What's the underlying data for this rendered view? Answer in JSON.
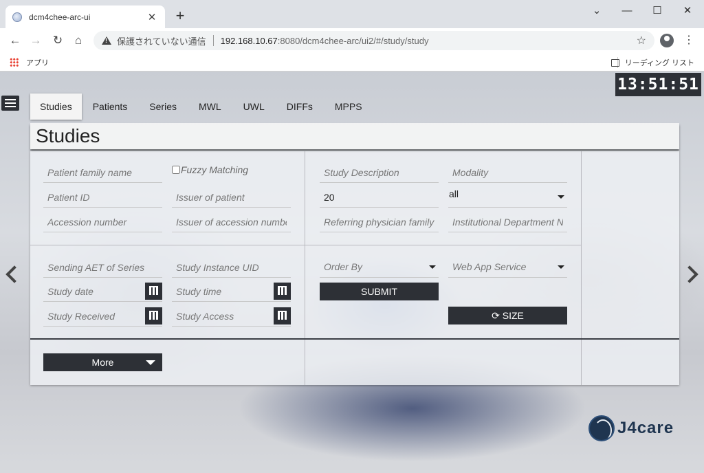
{
  "browser": {
    "tab_title": "dcm4chee-arc-ui",
    "tab_close": "✕",
    "new_tab": "+",
    "win_minimize": "⌄",
    "win_min": "—",
    "win_max": "☐",
    "win_close": "✕",
    "security_label": "保護されていない通信",
    "url_host": "192.168.10.67",
    "url_path": ":8080/dcm4chee-arc/ui2/#/study/study",
    "bookmark_apps": "アプリ",
    "reading_list": "リーディング リスト"
  },
  "clock": "13:51:51",
  "nav_tabs": [
    "Studies",
    "Patients",
    "Series",
    "MWL",
    "UWL",
    "DIFFs",
    "MPPS"
  ],
  "page_title": "Studies",
  "filters": {
    "patient_family_name": "Patient family name",
    "fuzzy_matching": "Fuzzy Matching",
    "patient_id": "Patient ID",
    "issuer_of_patient": "Issuer of patient",
    "accession_number": "Accession number",
    "issuer_of_accession": "Issuer of accession number",
    "study_description": "Study Description",
    "modality": "Modality",
    "limit_value": "20",
    "all_select": "all",
    "referring_physician": "Referring physician family name",
    "institutional_department": "Institutional Department Name",
    "sending_aet": "Sending AET of Series",
    "study_instance_uid": "Study Instance UID",
    "study_date": "Study date",
    "study_time": "Study time",
    "study_received": "Study Received",
    "study_access": "Study Access",
    "order_by": "Order By",
    "web_app_service": "Web App Service"
  },
  "buttons": {
    "submit": "SUBMIT",
    "size": "SIZE",
    "size_icon": "⟳",
    "more": "More"
  },
  "logo_text": "J4care"
}
